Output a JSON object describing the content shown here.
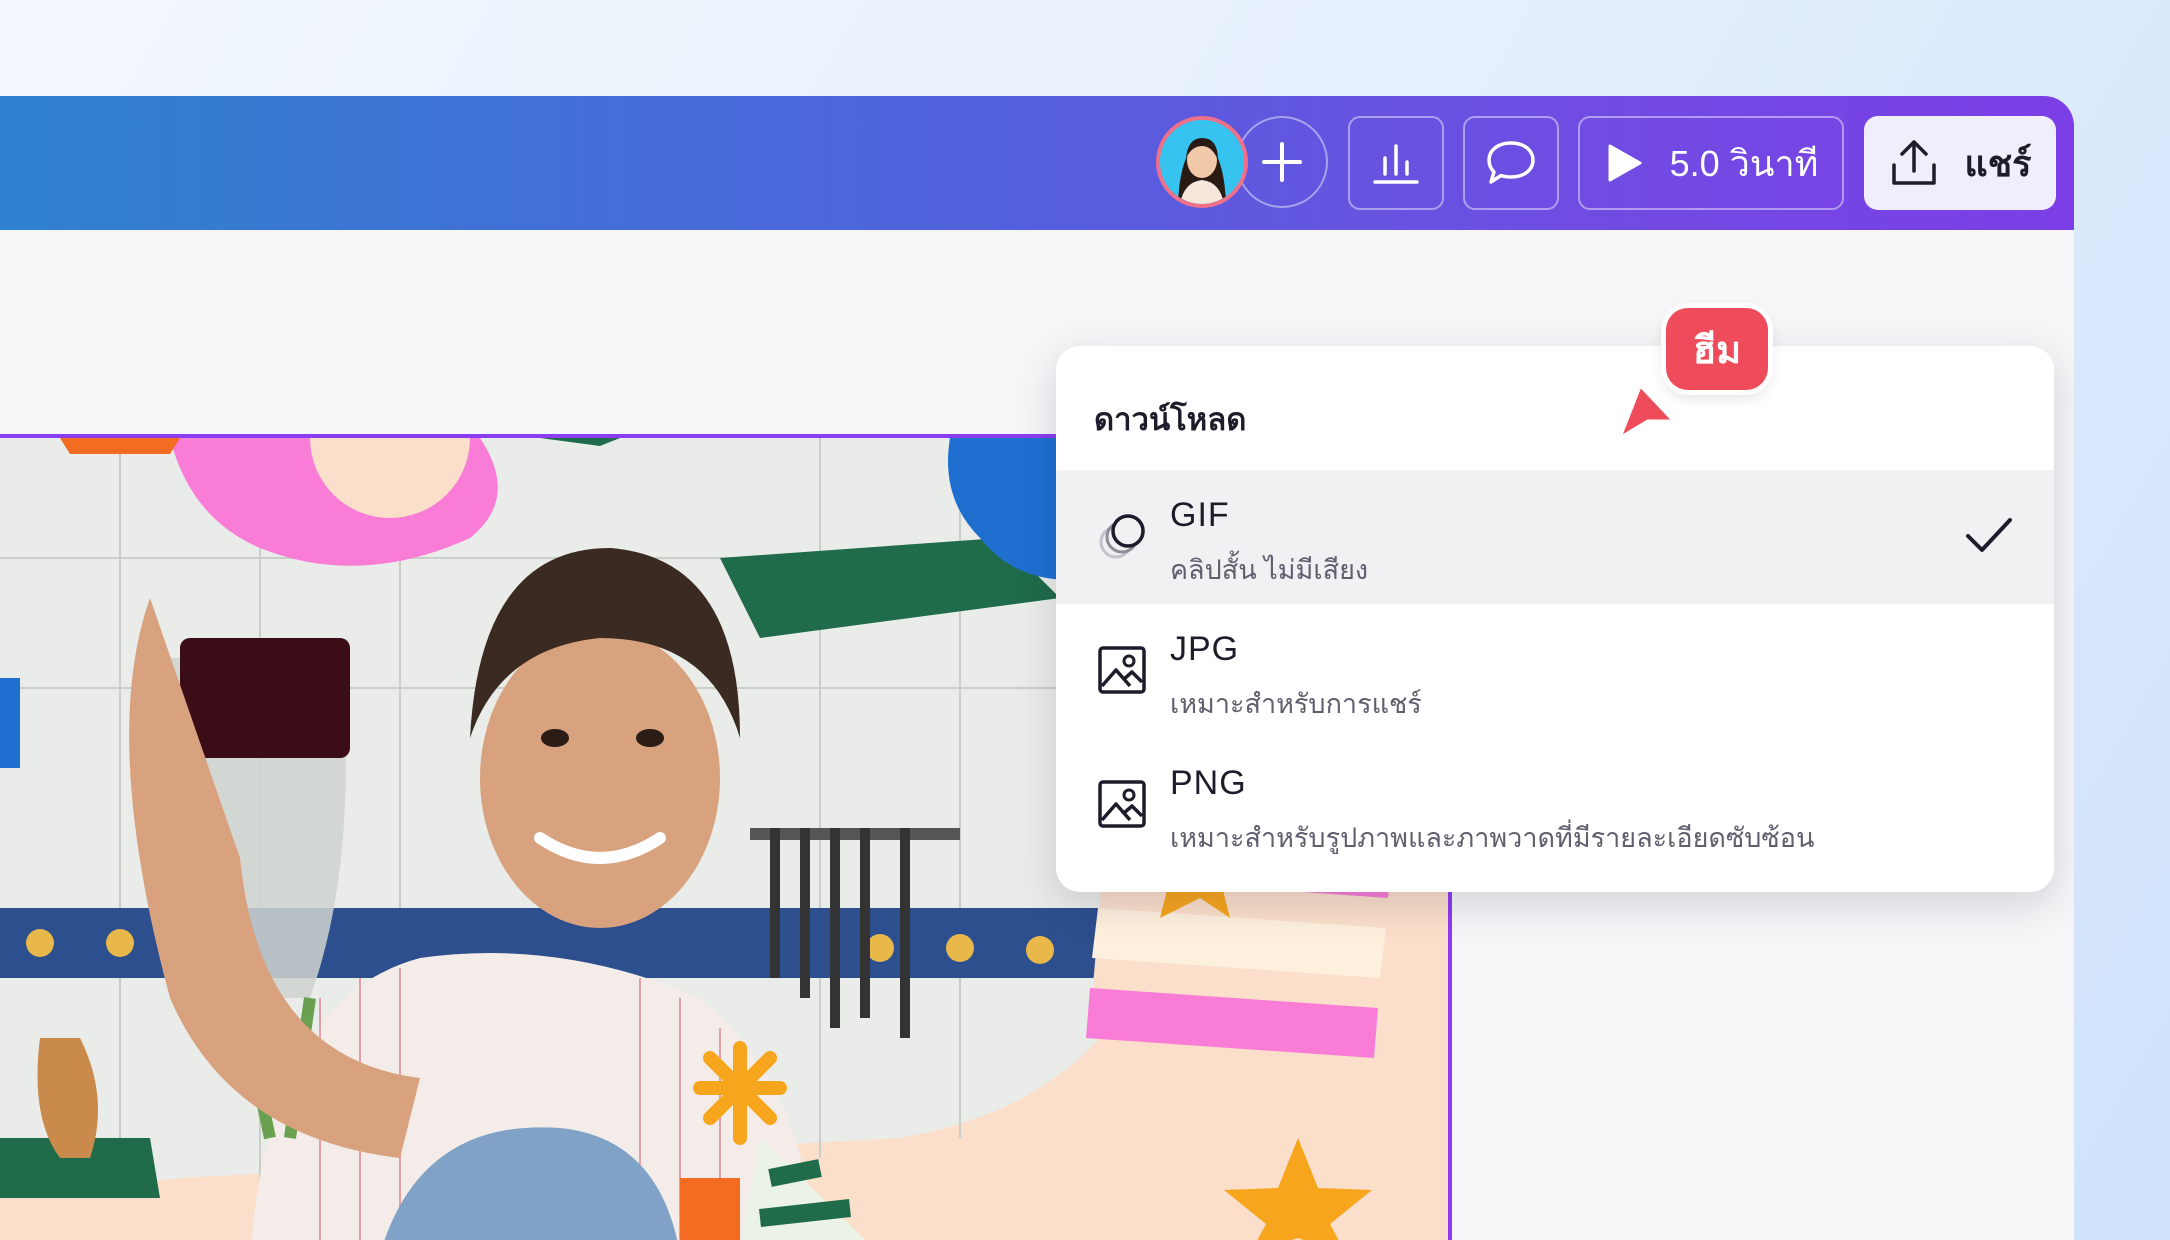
{
  "toolbar": {
    "play_duration_label": "5.0 วินาที",
    "share_label": "แชร์"
  },
  "download_menu": {
    "title": "ดาวน์โหลด",
    "items": [
      {
        "name": "GIF",
        "description": "คลิปสั้น ไม่มีเสียง",
        "selected": true,
        "icon": "gif-animation-icon"
      },
      {
        "name": "JPG",
        "description": "เหมาะสำหรับการแชร์",
        "selected": false,
        "icon": "image-icon"
      },
      {
        "name": "PNG",
        "description": "เหมาะสำหรับรูปภาพและภาพวาดที่มีรายละเอียดซับซ้อน",
        "selected": false,
        "icon": "image-icon"
      }
    ]
  },
  "collaborator_badge": "ฮีม",
  "colors": {
    "topbar_start": "#2f82cf",
    "topbar_end": "#7c3ee6",
    "badge": "#ef4c5b",
    "canvas_border": "#8b3df0"
  }
}
